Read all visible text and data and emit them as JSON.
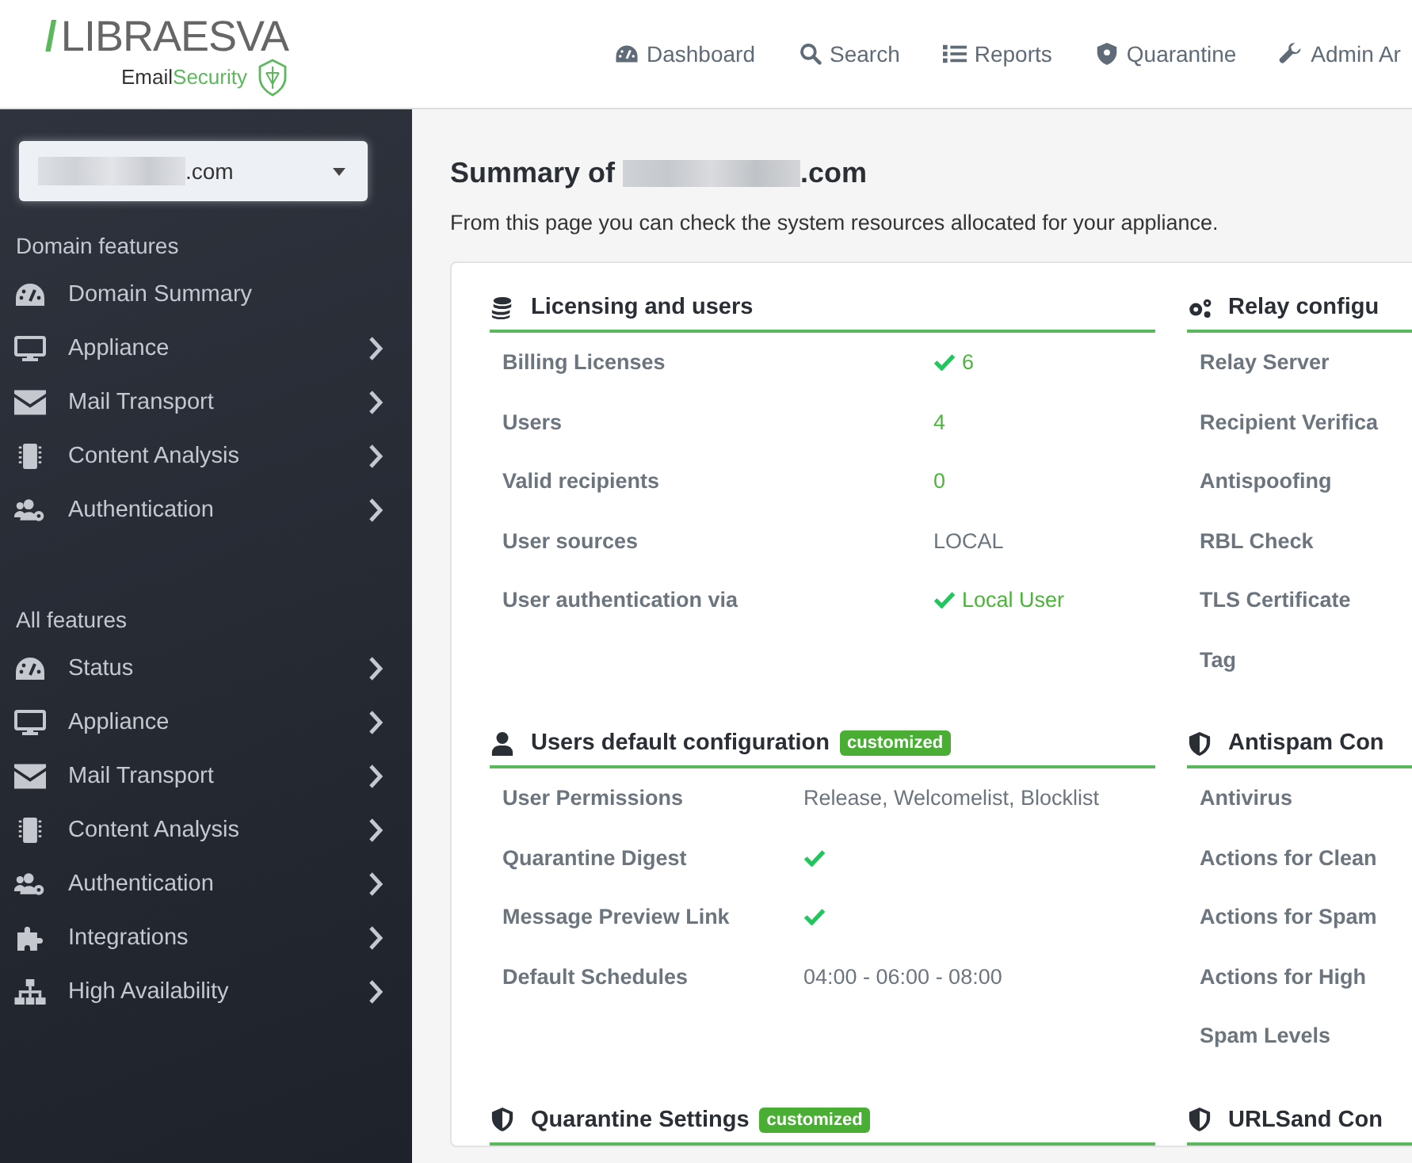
{
  "header": {
    "logo": {
      "slash": "/",
      "brand": "LIBRAESVA",
      "product_a": "Email",
      "product_b": "Security"
    },
    "nav": [
      {
        "label": "Dashboard",
        "kind": "gauge"
      },
      {
        "label": "Search",
        "kind": "search"
      },
      {
        "label": "Reports",
        "kind": "list"
      },
      {
        "label": "Quarantine",
        "kind": "shield"
      },
      {
        "label": "Admin Ar",
        "kind": "wrench"
      }
    ]
  },
  "sidebar": {
    "domain_select": {
      "value": ".com"
    },
    "groups": [
      {
        "title": "Domain features",
        "items": [
          {
            "label": "Domain Summary",
            "kind": "gauge",
            "expandable": false
          },
          {
            "label": "Appliance",
            "kind": "desktop",
            "expandable": true
          },
          {
            "label": "Mail Transport",
            "kind": "envelope",
            "expandable": true
          },
          {
            "label": "Content Analysis",
            "kind": "chip",
            "expandable": true
          },
          {
            "label": "Authentication",
            "kind": "users",
            "expandable": true
          }
        ]
      },
      {
        "title": "All features",
        "items": [
          {
            "label": "Status",
            "kind": "gauge",
            "expandable": true
          },
          {
            "label": "Appliance",
            "kind": "desktop",
            "expandable": true
          },
          {
            "label": "Mail Transport",
            "kind": "envelope",
            "expandable": true
          },
          {
            "label": "Content Analysis",
            "kind": "chip",
            "expandable": true
          },
          {
            "label": "Authentication",
            "kind": "users",
            "expandable": true
          },
          {
            "label": "Integrations",
            "kind": "puzzle",
            "expandable": true
          },
          {
            "label": "High Availability",
            "kind": "sitemap",
            "expandable": true
          }
        ]
      }
    ]
  },
  "main": {
    "title_prefix": "Summary of",
    "title_suffix": ".com",
    "description": "From this page you can check the system resources allocated for your appliance.",
    "sections": [
      {
        "title": "Licensing and users",
        "kind": "coins",
        "rows": [
          {
            "label": "Billing Licenses",
            "value": "6",
            "check": true,
            "highlight": true
          },
          {
            "label": "Users",
            "value": "4",
            "check": false,
            "highlight": true
          },
          {
            "label": "Valid recipients",
            "value": "0",
            "check": false,
            "highlight": true
          },
          {
            "label": "User sources",
            "value": "LOCAL",
            "check": false,
            "highlight": false
          },
          {
            "label": "User authentication via",
            "value": "Local User",
            "check": true,
            "highlight": true
          }
        ]
      },
      {
        "title": "Relay configu",
        "kind": "gears",
        "rows": [
          {
            "label": "Relay Server"
          },
          {
            "label": "Recipient Verifica"
          },
          {
            "label": "Antispoofing"
          },
          {
            "label": "RBL Check"
          },
          {
            "label": "TLS Certificate"
          },
          {
            "label": "Tag"
          }
        ]
      },
      {
        "title": "Users default configuration",
        "kind": "user",
        "badge": "customized",
        "rows": [
          {
            "label": "User Permissions",
            "value": "Release, Welcomelist, Blocklist",
            "check": false,
            "highlight": false
          },
          {
            "label": "Quarantine Digest",
            "check": true
          },
          {
            "label": "Message Preview Link",
            "check": true
          },
          {
            "label": "Default Schedules",
            "value": "04:00 - 06:00 - 08:00",
            "check": false,
            "highlight": false
          }
        ]
      },
      {
        "title": "Antispam Con",
        "kind": "shield-half",
        "rows": [
          {
            "label": "Antivirus"
          },
          {
            "label": "Actions for Clean"
          },
          {
            "label": "Actions for Spam"
          },
          {
            "label": "Actions for High"
          },
          {
            "label": "Spam Levels"
          }
        ]
      },
      {
        "title": "Quarantine Settings",
        "kind": "shield-half",
        "badge": "customized"
      },
      {
        "title": "URLSand Con",
        "kind": "shield-half"
      }
    ]
  }
}
